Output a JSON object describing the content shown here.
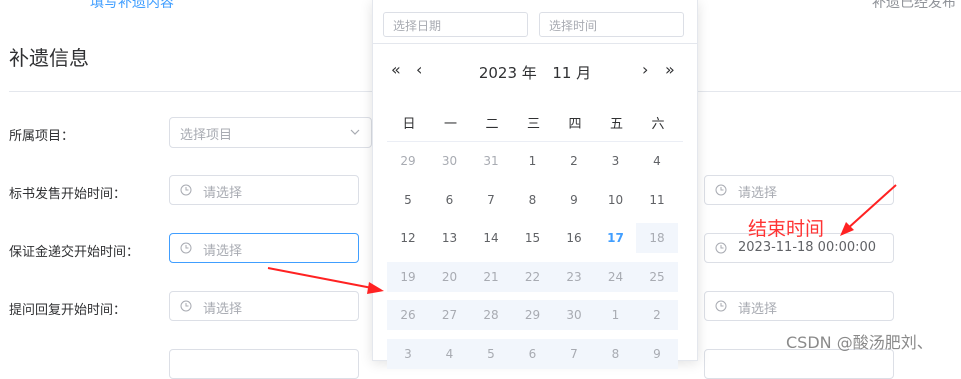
{
  "section_title": "补遗信息",
  "top_strip": {
    "left_text": "填写补遗内容",
    "right_text": "补遗已经发布"
  },
  "form": {
    "project": {
      "label": "所属项目：",
      "placeholder": "选择项目"
    },
    "bid_sale_start": {
      "label": "标书发售开始时间：",
      "placeholder": "请选择",
      "end_placeholder": "请选择"
    },
    "deposit_start": {
      "label": "保证金递交开始时间：",
      "placeholder": "请选择",
      "end_value": "2023-11-18 00:00:00"
    },
    "qa_start": {
      "label": "提问回复开始时间：",
      "placeholder": "请选择",
      "end_placeholder": "请选择"
    }
  },
  "date_picker": {
    "date_placeholder": "选择日期",
    "time_placeholder": "选择时间",
    "year": "2023 年",
    "month": "11 月",
    "prev_year": "«",
    "prev_month": "‹",
    "next_month": "›",
    "next_year": "»",
    "weekdays": [
      "日",
      "一",
      "二",
      "三",
      "四",
      "五",
      "六"
    ],
    "weeks": [
      [
        {
          "d": "29",
          "t": "prev"
        },
        {
          "d": "30",
          "t": "prev"
        },
        {
          "d": "31",
          "t": "prev"
        },
        {
          "d": "1",
          "t": "cur"
        },
        {
          "d": "2",
          "t": "cur"
        },
        {
          "d": "3",
          "t": "cur"
        },
        {
          "d": "4",
          "t": "cur"
        }
      ],
      [
        {
          "d": "5",
          "t": "cur"
        },
        {
          "d": "6",
          "t": "cur"
        },
        {
          "d": "7",
          "t": "cur"
        },
        {
          "d": "8",
          "t": "cur"
        },
        {
          "d": "9",
          "t": "cur"
        },
        {
          "d": "10",
          "t": "cur"
        },
        {
          "d": "11",
          "t": "cur"
        }
      ],
      [
        {
          "d": "12",
          "t": "cur"
        },
        {
          "d": "13",
          "t": "cur"
        },
        {
          "d": "14",
          "t": "cur"
        },
        {
          "d": "15",
          "t": "cur"
        },
        {
          "d": "16",
          "t": "cur"
        },
        {
          "d": "17",
          "t": "today"
        },
        {
          "d": "18",
          "t": "disabled"
        }
      ],
      [
        {
          "d": "19",
          "t": "disabled"
        },
        {
          "d": "20",
          "t": "disabled"
        },
        {
          "d": "21",
          "t": "disabled"
        },
        {
          "d": "22",
          "t": "disabled"
        },
        {
          "d": "23",
          "t": "disabled"
        },
        {
          "d": "24",
          "t": "disabled"
        },
        {
          "d": "25",
          "t": "disabled"
        }
      ],
      [
        {
          "d": "26",
          "t": "disabled"
        },
        {
          "d": "27",
          "t": "disabled"
        },
        {
          "d": "28",
          "t": "disabled"
        },
        {
          "d": "29",
          "t": "disabled"
        },
        {
          "d": "30",
          "t": "disabled"
        },
        {
          "d": "1",
          "t": "disabled"
        },
        {
          "d": "2",
          "t": "disabled"
        }
      ],
      [
        {
          "d": "3",
          "t": "disabled"
        },
        {
          "d": "4",
          "t": "disabled"
        },
        {
          "d": "5",
          "t": "disabled"
        },
        {
          "d": "6",
          "t": "disabled"
        },
        {
          "d": "7",
          "t": "disabled"
        },
        {
          "d": "8",
          "t": "disabled"
        },
        {
          "d": "9",
          "t": "disabled"
        }
      ]
    ]
  },
  "annotation": "结束时间",
  "watermark": "CSDN @酸汤肥刘、",
  "colors": {
    "accent": "#409eff",
    "annotation": "#ff3333",
    "disabled_bg": "#f2f6fc"
  }
}
